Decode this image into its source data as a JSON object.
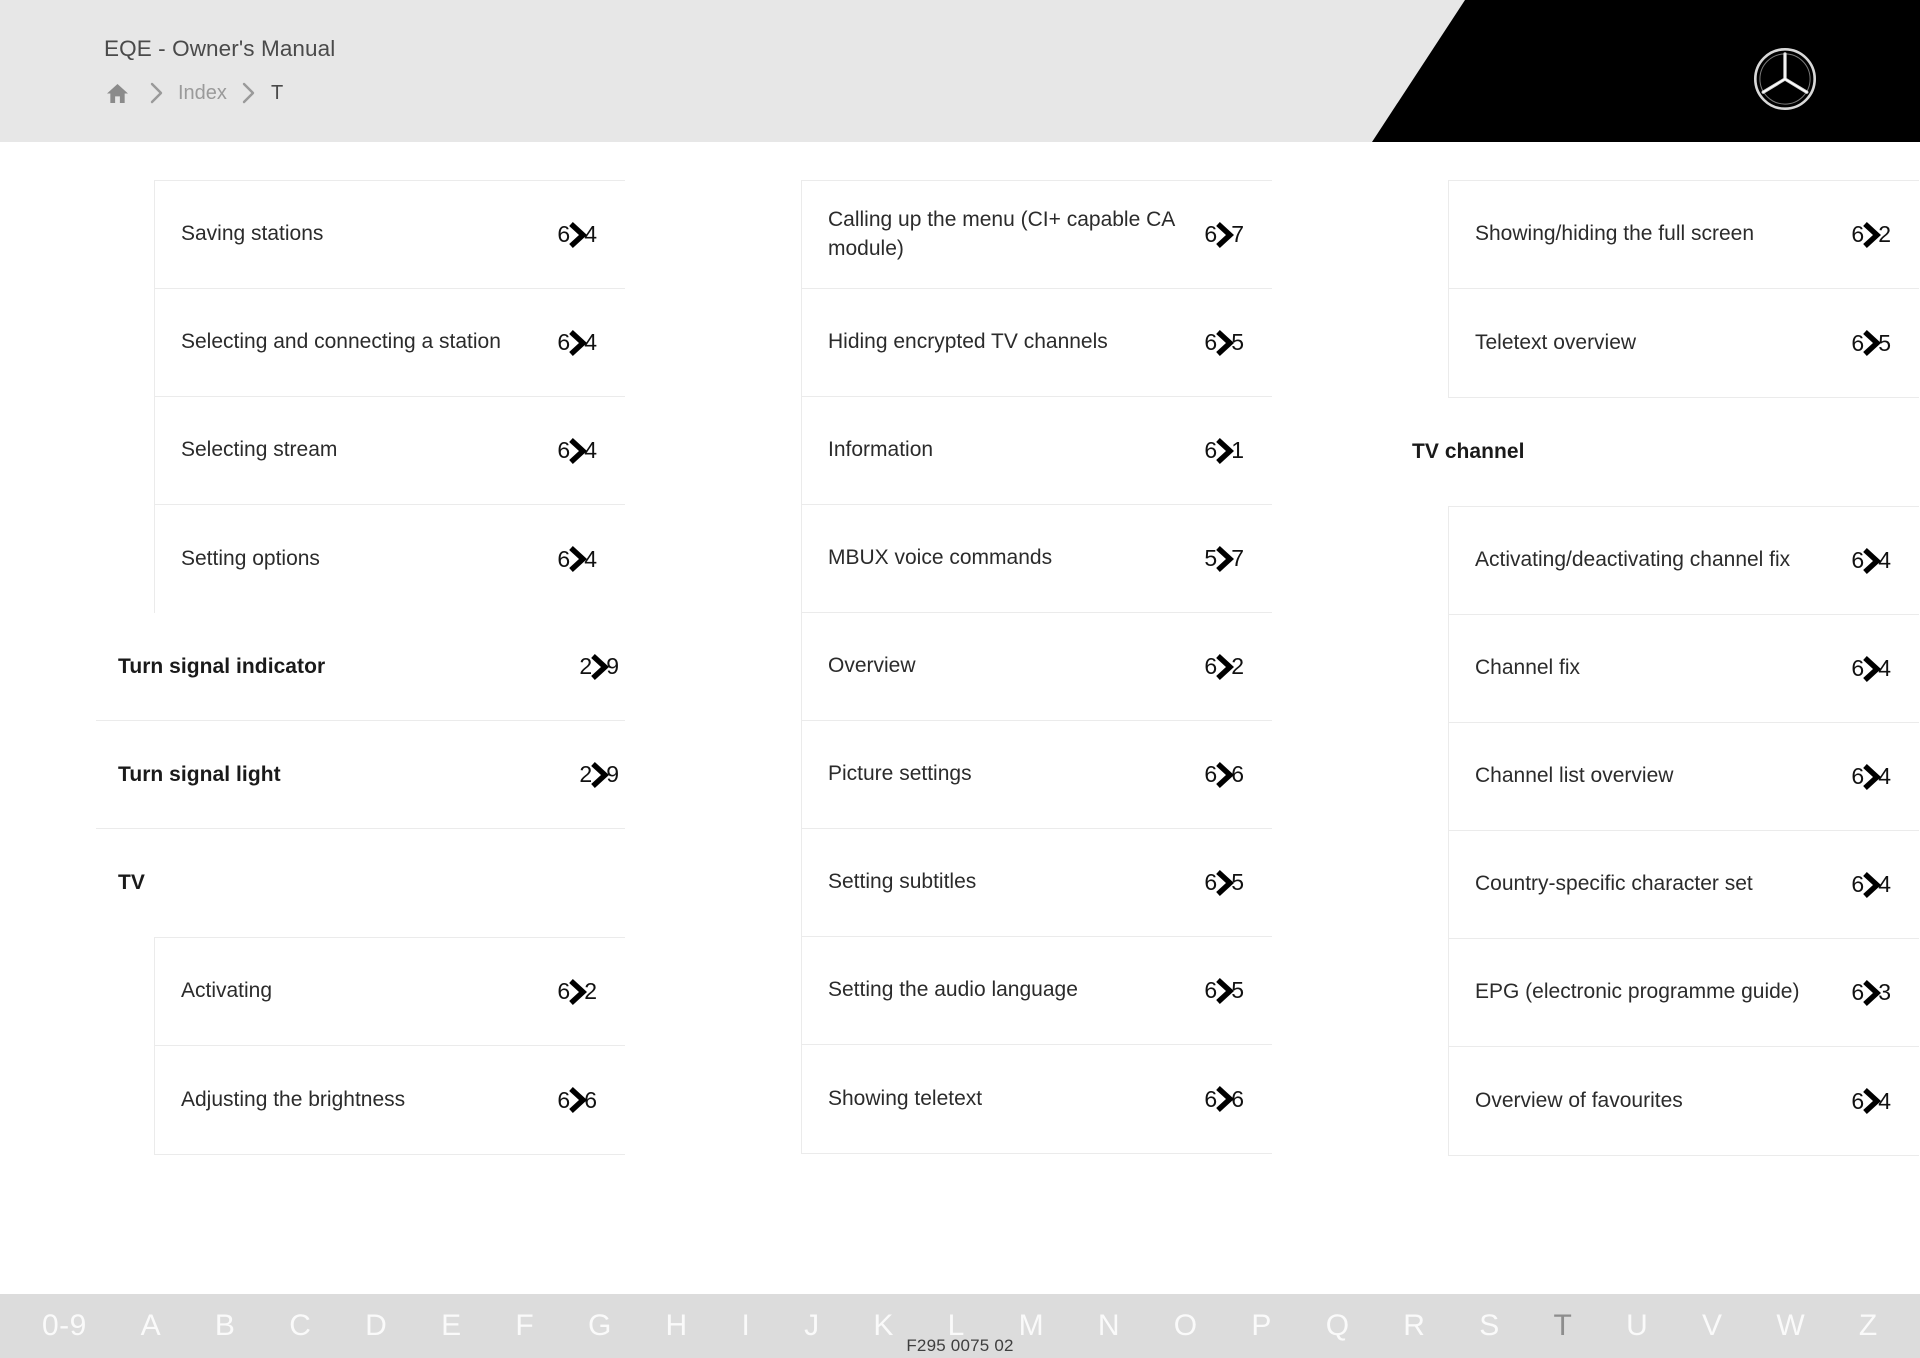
{
  "header": {
    "manual_title": "EQE - Owner's Manual",
    "breadcrumb": [
      {
        "icon": "home-icon",
        "label": ""
      },
      {
        "icon": "chevron-right-icon",
        "label": "Index"
      },
      {
        "icon": "chevron-right-icon",
        "label": "T"
      }
    ],
    "brand_logo": "mercedes-benz-star-icon"
  },
  "index": {
    "columns": [
      {
        "blocks": [
          {
            "type": "group",
            "indented": true,
            "capped": false,
            "items": [
              {
                "label": "Saving stations",
                "page_left": "6",
                "page_right": "4"
              },
              {
                "label": "Selecting and connecting a station",
                "page_left": "6",
                "page_right": "4"
              },
              {
                "label": "Selecting stream",
                "page_left": "6",
                "page_right": "4"
              },
              {
                "label": "Setting options",
                "page_left": "6",
                "page_right": "4"
              }
            ]
          },
          {
            "type": "heading",
            "label": "Turn signal indicator",
            "page_left": "2",
            "page_right": "9"
          },
          {
            "type": "heading",
            "label": "Turn signal light",
            "page_left": "2",
            "page_right": "9"
          },
          {
            "type": "heading",
            "label": "TV",
            "page_left": "",
            "page_right": ""
          },
          {
            "type": "group",
            "indented": true,
            "capped": true,
            "items": [
              {
                "label": "Activating",
                "page_left": "6",
                "page_right": "2"
              },
              {
                "label": "Adjusting the brightness",
                "page_left": "6",
                "page_right": "6"
              }
            ]
          }
        ]
      },
      {
        "blocks": [
          {
            "type": "group",
            "indented": true,
            "capped": true,
            "items": [
              {
                "label": "Calling up the menu (CI+ capable CA module)",
                "page_left": "6",
                "page_right": "7"
              },
              {
                "label": "Hiding encrypted TV channels",
                "page_left": "6",
                "page_right": "5"
              },
              {
                "label": "Information",
                "page_left": "6",
                "page_right": "1"
              },
              {
                "label": "MBUX voice commands",
                "page_left": "5",
                "page_right": "7"
              },
              {
                "label": "Overview",
                "page_left": "6",
                "page_right": "2"
              },
              {
                "label": "Picture settings",
                "page_left": "6",
                "page_right": "6"
              },
              {
                "label": "Setting subtitles",
                "page_left": "6",
                "page_right": "5"
              },
              {
                "label": "Setting the audio language",
                "page_left": "6",
                "page_right": "5"
              },
              {
                "label": "Showing teletext",
                "page_left": "6",
                "page_right": "6"
              }
            ]
          }
        ]
      },
      {
        "blocks": [
          {
            "type": "group",
            "indented": true,
            "capped": true,
            "items": [
              {
                "label": "Showing/hiding the full screen",
                "page_left": "6",
                "page_right": "2"
              },
              {
                "label": "Teletext overview",
                "page_left": "6",
                "page_right": "5"
              }
            ]
          },
          {
            "type": "heading",
            "label": "TV channel",
            "page_left": "",
            "page_right": ""
          },
          {
            "type": "group",
            "indented": true,
            "capped": true,
            "items": [
              {
                "label": "Activating/deactivating channel fix",
                "page_left": "6",
                "page_right": "4"
              },
              {
                "label": "Channel fix",
                "page_left": "6",
                "page_right": "4"
              },
              {
                "label": "Channel list overview",
                "page_left": "6",
                "page_right": "4"
              },
              {
                "label": "Country-specific character set",
                "page_left": "6",
                "page_right": "4"
              },
              {
                "label": "EPG (electronic programme guide)",
                "page_left": "6",
                "page_right": "3"
              },
              {
                "label": "Overview of favourites",
                "page_left": "6",
                "page_right": "4"
              }
            ]
          }
        ]
      }
    ]
  },
  "footer": {
    "alphabet": [
      "0-9",
      "A",
      "B",
      "C",
      "D",
      "E",
      "F",
      "G",
      "H",
      "I",
      "J",
      "K",
      "L",
      "M",
      "N",
      "O",
      "P",
      "Q",
      "R",
      "S",
      "T",
      "U",
      "V",
      "W",
      "Z"
    ],
    "active_letter": "T",
    "doc_code": "F295 0075 02"
  }
}
